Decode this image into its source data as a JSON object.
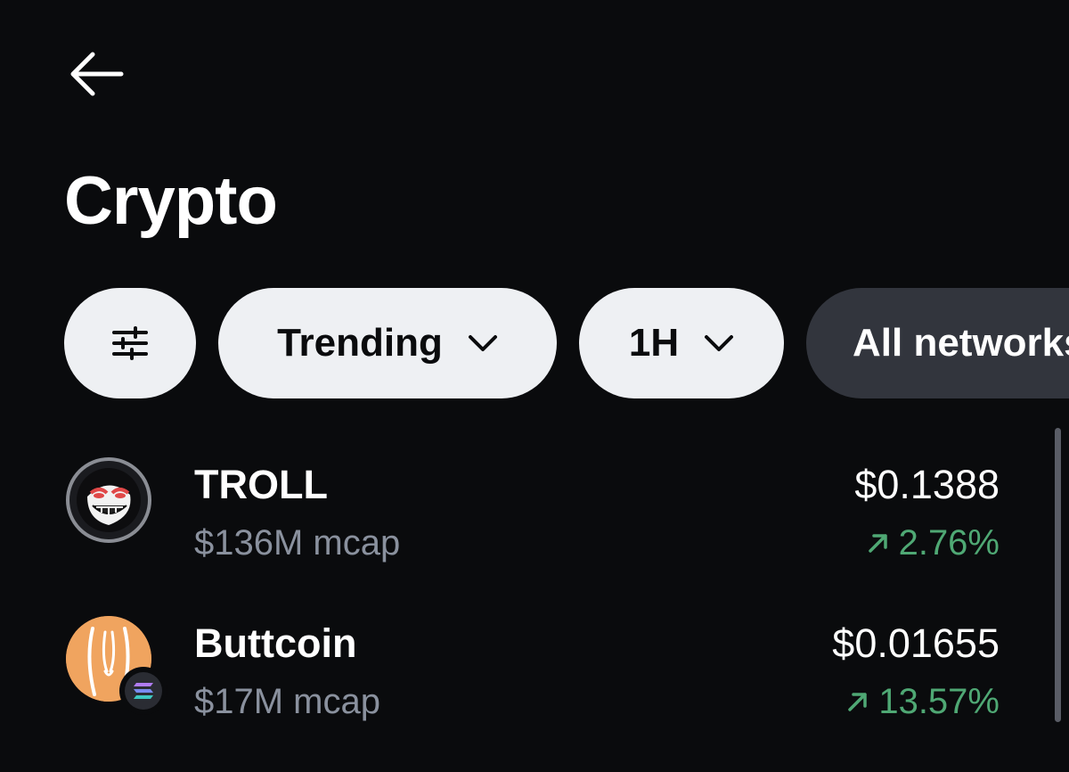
{
  "header": {
    "back_label": "Back",
    "title": "Crypto"
  },
  "filters": {
    "filter_icon": "sliders-icon",
    "sort_label": "Trending",
    "period_label": "1H",
    "network_label": "All networks"
  },
  "assets": [
    {
      "name": "TROLL",
      "mcap": "$136M mcap",
      "price": "$0.1388",
      "change": "2.76%",
      "direction": "up",
      "logo": "troll-face-icon"
    },
    {
      "name": "Buttcoin",
      "mcap": "$17M mcap",
      "price": "$0.01655",
      "change": "13.57%",
      "direction": "up",
      "logo": "buttcoin-logo",
      "network_badge": "solana-icon"
    }
  ],
  "colors": {
    "background": "#0a0b0d",
    "chip_light": "#eef0f3",
    "chip_dark": "#32353d",
    "positive": "#4fa874",
    "muted_text": "#8a919e"
  }
}
